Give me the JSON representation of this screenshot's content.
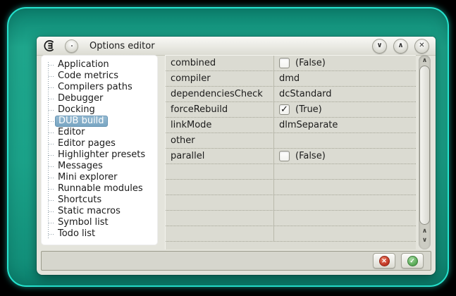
{
  "titlebar": {
    "title": "Options editor"
  },
  "icons": {
    "chevron_down": "∨",
    "chevron_up": "∧",
    "close": "✕",
    "check": "✓",
    "cross": "✕",
    "scroll_up": "∧",
    "scroll_down": "∨"
  },
  "sidebar": {
    "items": [
      {
        "label": "Application",
        "selected": false
      },
      {
        "label": "Code metrics",
        "selected": false
      },
      {
        "label": "Compilers paths",
        "selected": false
      },
      {
        "label": "Debugger",
        "selected": false
      },
      {
        "label": "Docking",
        "selected": false
      },
      {
        "label": "DUB build",
        "selected": true
      },
      {
        "label": "Editor",
        "selected": false
      },
      {
        "label": "Editor pages",
        "selected": false
      },
      {
        "label": "Highlighter presets",
        "selected": false
      },
      {
        "label": "Messages",
        "selected": false
      },
      {
        "label": "Mini explorer",
        "selected": false
      },
      {
        "label": "Runnable modules",
        "selected": false
      },
      {
        "label": "Shortcuts",
        "selected": false
      },
      {
        "label": "Static macros",
        "selected": false
      },
      {
        "label": "Symbol list",
        "selected": false
      },
      {
        "label": "Todo list",
        "selected": false
      }
    ]
  },
  "property_grid": {
    "rows": [
      {
        "name": "combined",
        "type": "checkbox",
        "checked": false,
        "value": "(False)"
      },
      {
        "name": "compiler",
        "type": "text",
        "value": "dmd"
      },
      {
        "name": "dependenciesCheck",
        "type": "text",
        "value": "dcStandard"
      },
      {
        "name": "forceRebuild",
        "type": "checkbox",
        "checked": true,
        "value": "(True)"
      },
      {
        "name": "linkMode",
        "type": "text",
        "value": "dlmSeparate"
      },
      {
        "name": "other",
        "type": "text",
        "value": ""
      },
      {
        "name": "parallel",
        "type": "checkbox",
        "checked": false,
        "value": "(False)"
      }
    ],
    "empty_filler_rows": 5
  },
  "footer": {
    "buttons": [
      {
        "name": "cancel",
        "icon": "red-cross"
      },
      {
        "name": "accept",
        "icon": "green-check"
      }
    ]
  },
  "colors": {
    "desktop_teal": "#17A189",
    "desktop_border": "#25E3CE",
    "selection_blue": "#78A5C2",
    "cancel_red": "#BF3322",
    "accept_green": "#54A752",
    "window_bg": "#E4E4DC",
    "grid_bg": "#DBDBD2"
  }
}
